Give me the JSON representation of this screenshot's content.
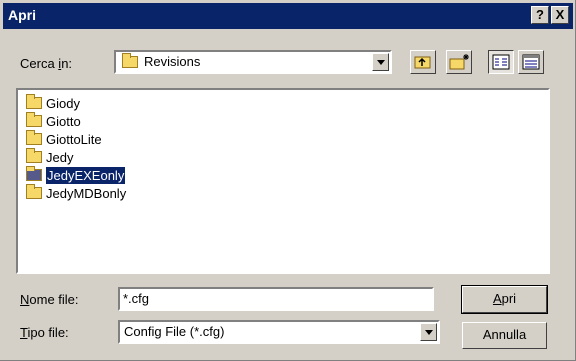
{
  "window": {
    "title": "Apri",
    "help_btn": "?",
    "close_btn": "X"
  },
  "lookin": {
    "label_pre": "Cerca ",
    "label_mnemonic": "i",
    "label_post": "n:",
    "value": "Revisions"
  },
  "toolbar": {
    "icons": [
      "up-folder-icon",
      "new-folder-icon",
      "list-view-icon",
      "details-view-icon"
    ]
  },
  "files": [
    {
      "name": "Giody"
    },
    {
      "name": "Giotto"
    },
    {
      "name": "GiottoLite"
    },
    {
      "name": "Jedy"
    },
    {
      "name": "JedyEXEonly",
      "selected": true
    },
    {
      "name": "JedyMDBonly"
    }
  ],
  "filename": {
    "label_mnemonic": "N",
    "label_rest": "ome file:",
    "value": "*.cfg"
  },
  "filetype": {
    "label_mnemonic": "T",
    "label_rest": "ipo file:",
    "value": "Config File (*.cfg)"
  },
  "buttons": {
    "open_mnemonic": "A",
    "open_rest": "pri",
    "cancel": "Annulla"
  },
  "colors": {
    "titlebar": "#0a246a",
    "selection": "#0a246a",
    "face": "#d4d0c8",
    "folder": "#f5d867"
  }
}
